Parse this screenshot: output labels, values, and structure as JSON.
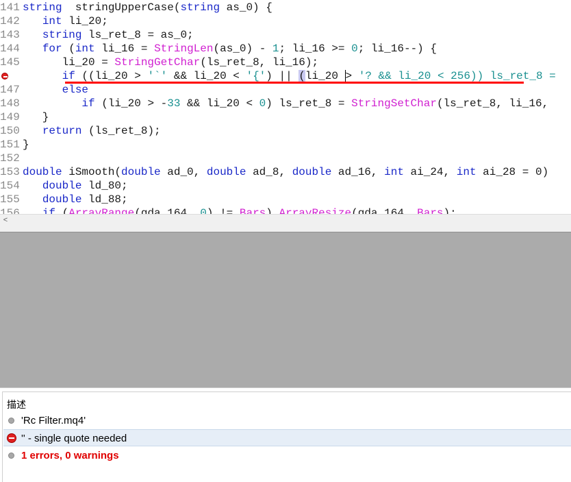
{
  "editor": {
    "lines": [
      {
        "num": "141",
        "tokens": [
          [
            "kw",
            "string"
          ],
          [
            "",
            "  stringUpperCase("
          ],
          [
            "kw",
            "string"
          ],
          [
            "",
            " as_0) {"
          ]
        ]
      },
      {
        "num": "142",
        "tokens": [
          [
            "",
            "   "
          ],
          [
            "kw",
            "int"
          ],
          [
            "",
            " li_20;"
          ]
        ]
      },
      {
        "num": "143",
        "tokens": [
          [
            "",
            "   "
          ],
          [
            "kw",
            "string"
          ],
          [
            "",
            " ls_ret_8 = as_0;"
          ]
        ]
      },
      {
        "num": "144",
        "tokens": [
          [
            "",
            "   "
          ],
          [
            "kw",
            "for"
          ],
          [
            "",
            " ("
          ],
          [
            "kw",
            "int"
          ],
          [
            "",
            " li_16 = "
          ],
          [
            "fn",
            "StringLen"
          ],
          [
            "",
            "(as_0) - "
          ],
          [
            "num",
            "1"
          ],
          [
            "",
            "; li_16 >= "
          ],
          [
            "num",
            "0"
          ],
          [
            "",
            "; li_16--) {"
          ]
        ]
      },
      {
        "num": "145",
        "tokens": [
          [
            "",
            "      li_20 = "
          ],
          [
            "fn",
            "StringGetChar"
          ],
          [
            "",
            "(ls_ret_8, li_16);"
          ]
        ]
      },
      {
        "num": "146",
        "tokens": [
          [
            "",
            "      "
          ],
          [
            "kw",
            "if"
          ],
          [
            "",
            " ((li_20 > "
          ],
          [
            "str",
            "'`'"
          ],
          [
            "",
            " && li_20 < "
          ],
          [
            "str",
            "'{'"
          ],
          [
            "",
            ") || "
          ],
          [
            "hl",
            "("
          ],
          [
            "",
            "li_20 "
          ],
          [
            "cursor",
            ">"
          ],
          [
            "",
            " "
          ],
          [
            "str",
            "'? && li_20 < 256)) ls_ret_8 ="
          ]
        ]
      },
      {
        "num": "147",
        "tokens": [
          [
            "",
            "      "
          ],
          [
            "kw",
            "else"
          ]
        ]
      },
      {
        "num": "148",
        "tokens": [
          [
            "",
            "         "
          ],
          [
            "kw",
            "if"
          ],
          [
            "",
            " (li_20 > -"
          ],
          [
            "num",
            "33"
          ],
          [
            "",
            " && li_20 < "
          ],
          [
            "num",
            "0"
          ],
          [
            "",
            ") ls_ret_8 = "
          ],
          [
            "fn",
            "StringSetChar"
          ],
          [
            "",
            "(ls_ret_8, li_16,"
          ]
        ]
      },
      {
        "num": "149",
        "tokens": [
          [
            "",
            "   }"
          ]
        ]
      },
      {
        "num": "150",
        "tokens": [
          [
            "",
            "   "
          ],
          [
            "kw",
            "return"
          ],
          [
            "",
            " (ls_ret_8);"
          ]
        ]
      },
      {
        "num": "151",
        "tokens": [
          [
            "",
            "}"
          ]
        ]
      },
      {
        "num": "152",
        "tokens": []
      },
      {
        "num": "153",
        "tokens": [
          [
            "kw",
            "double"
          ],
          [
            "",
            " iSmooth("
          ],
          [
            "kw",
            "double"
          ],
          [
            "",
            " ad_0, "
          ],
          [
            "kw",
            "double"
          ],
          [
            "",
            " ad_8, "
          ],
          [
            "kw",
            "double"
          ],
          [
            "",
            " ad_16, "
          ],
          [
            "kw",
            "int"
          ],
          [
            "",
            " ai_24, "
          ],
          [
            "kw",
            "int"
          ],
          [
            "",
            " ai_28 = 0)"
          ]
        ]
      },
      {
        "num": "154",
        "tokens": [
          [
            "",
            "   "
          ],
          [
            "kw",
            "double"
          ],
          [
            "",
            " ld_80;"
          ]
        ]
      },
      {
        "num": "155",
        "tokens": [
          [
            "",
            "   "
          ],
          [
            "kw",
            "double"
          ],
          [
            "",
            " ld_88;"
          ]
        ]
      },
      {
        "num": "156",
        "tokens": [
          [
            "",
            "   "
          ],
          [
            "kw",
            "if"
          ],
          [
            "",
            " ("
          ],
          [
            "fn",
            "ArrayRange"
          ],
          [
            "",
            "(gda_164, "
          ],
          [
            "num",
            "0"
          ],
          [
            "",
            ") != "
          ],
          [
            "fn",
            "Bars"
          ],
          [
            "",
            ") "
          ],
          [
            "fn",
            "ArrayResize"
          ],
          [
            "",
            "(gda_164, "
          ],
          [
            "fn",
            "Bars"
          ],
          [
            "",
            ");"
          ]
        ]
      }
    ]
  },
  "panel": {
    "header": "描述",
    "rows": [
      {
        "text": "'Rc Filter.mq4'",
        "icon": "info-dot-icon",
        "style": "normal"
      },
      {
        "text": "'' - single quote needed",
        "icon": "error-icon",
        "style": "normal"
      },
      {
        "text": "1 errors, 0 warnings",
        "icon": "info-dot-icon",
        "style": "red"
      }
    ]
  },
  "colors": {
    "keyword": "#1a28c8",
    "function": "#d01fd0",
    "number": "#1a9090",
    "error": "#e00000",
    "gray_area": "#ababab"
  }
}
